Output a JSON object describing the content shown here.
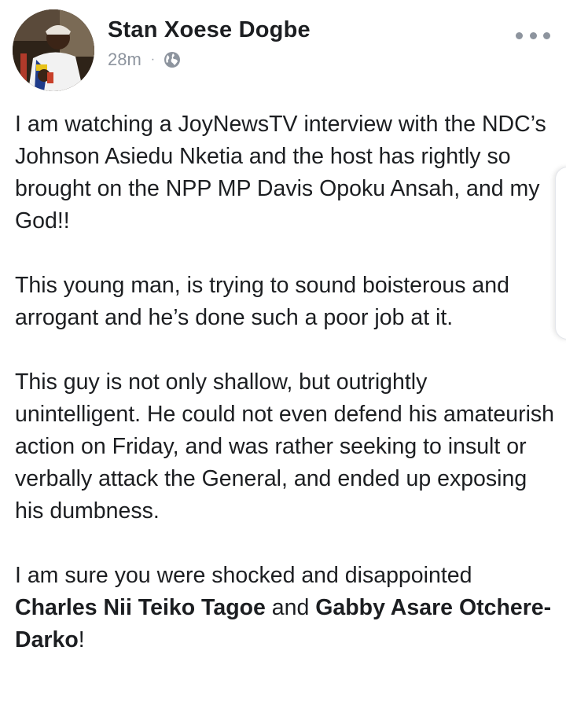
{
  "post": {
    "author": "Stan Xoese Dogbe",
    "timestamp": "28m",
    "separator": "·",
    "audience_icon": "globe-icon",
    "more_icon": "more-horizontal-icon",
    "paragraphs": {
      "p1": "I am watching a JoyNewsTV interview with the NDC’s Johnson Asiedu Nketia and the host has rightly so brought on the NPP MP Davis Opoku Ansah, and my God!!",
      "p2": "This young man, is trying to sound boisterous and arrogant and he’s done such a poor job at it.",
      "p3": "This guy is not only shallow, but outrightly unintelligent. He could not even defend his amateurish action on Friday, and was rather seeking to insult or verbally attack the General, and ended up exposing his dumbness.",
      "p4": {
        "before": "I am sure you were shocked and disappointed ",
        "mention1": "Charles Nii Teiko Tagoe",
        "middle": " and ",
        "mention2": "Gabby Asare Otchere-Darko",
        "after": "!"
      }
    }
  },
  "colors": {
    "text": "#1c1e21",
    "meta": "#8d949e",
    "background": "#ffffff"
  }
}
